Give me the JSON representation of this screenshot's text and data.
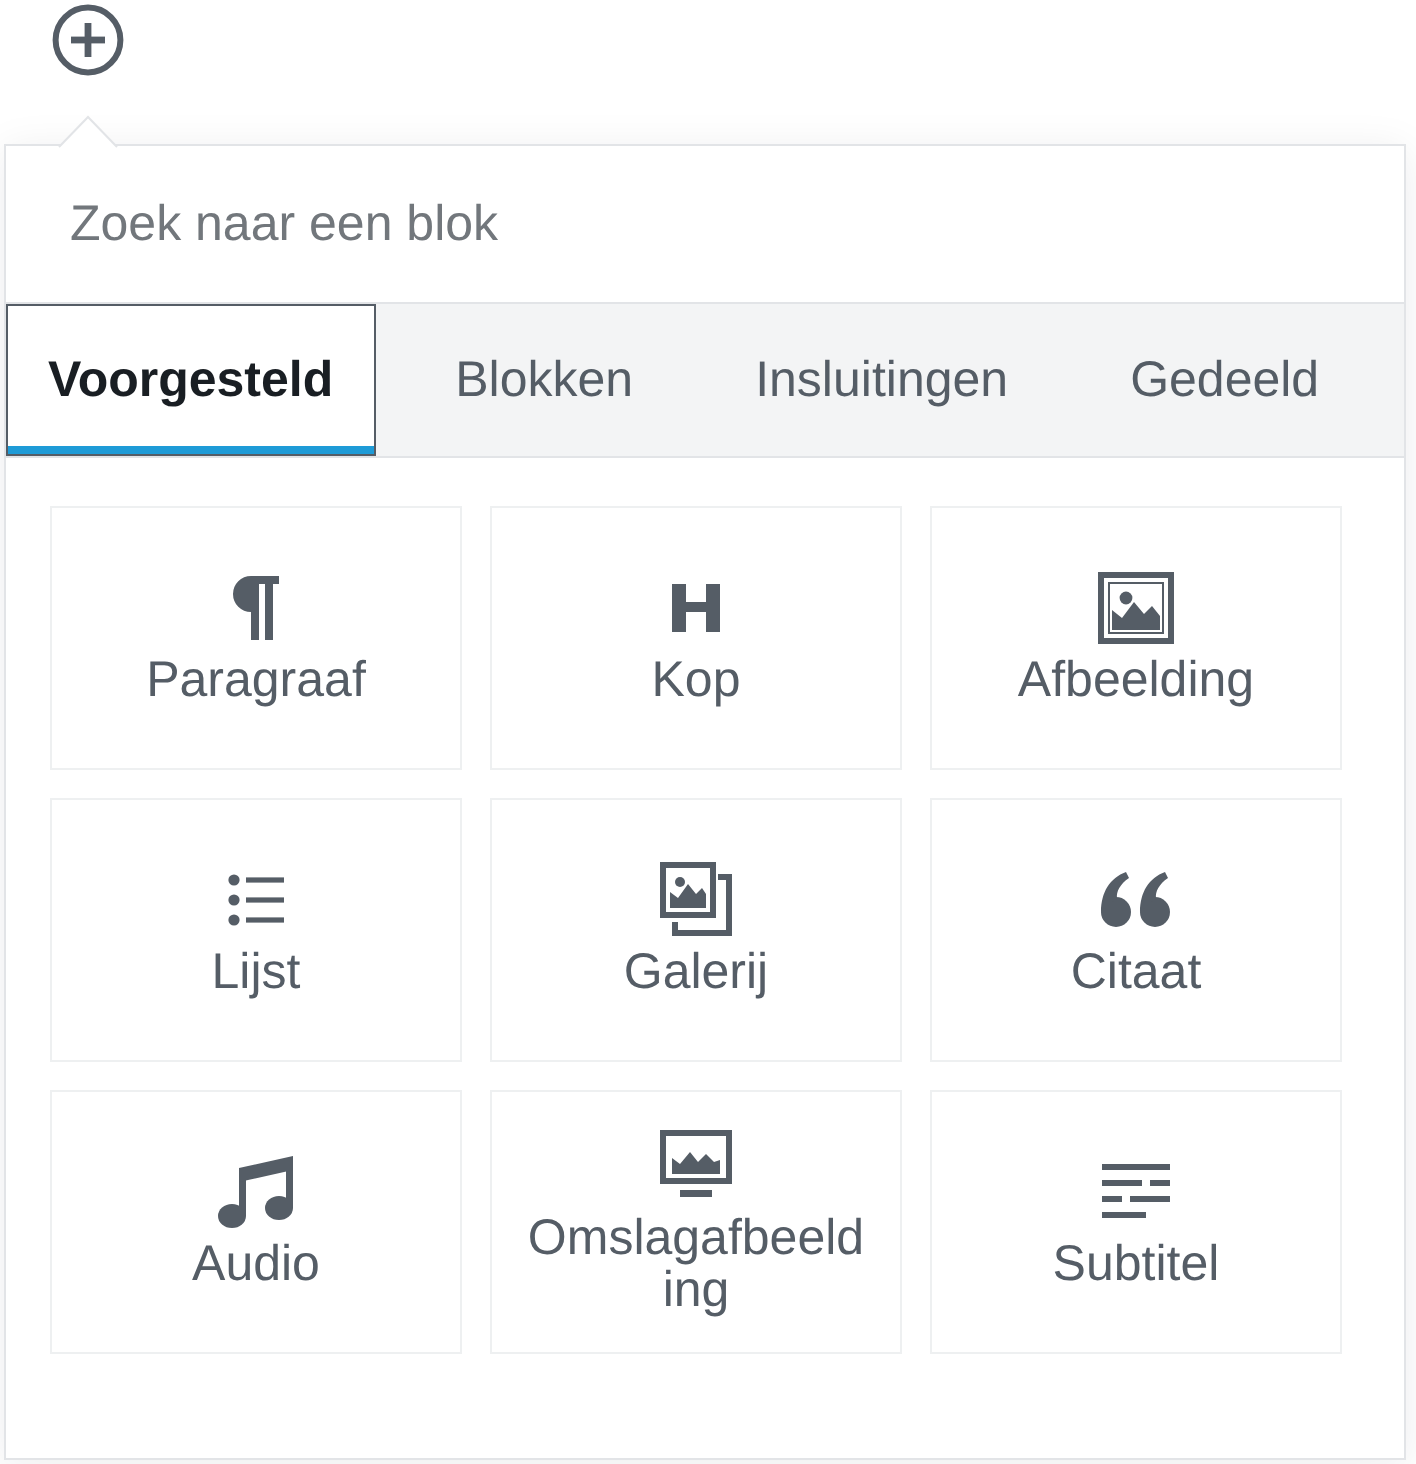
{
  "search": {
    "placeholder": "Zoek naar een blok"
  },
  "tabs": [
    {
      "label": "Voorgesteld",
      "selected": true
    },
    {
      "label": "Blokken",
      "selected": false
    },
    {
      "label": "Insluitingen",
      "selected": false
    },
    {
      "label": "Gedeeld",
      "selected": false
    }
  ],
  "blocks": [
    {
      "kind": "paragraph",
      "label": "Paragraaf"
    },
    {
      "kind": "heading",
      "label": "Kop"
    },
    {
      "kind": "image",
      "label": "Afbeelding"
    },
    {
      "kind": "list",
      "label": "Lijst"
    },
    {
      "kind": "gallery",
      "label": "Galerij"
    },
    {
      "kind": "quote",
      "label": "Citaat"
    },
    {
      "kind": "audio",
      "label": "Audio"
    },
    {
      "kind": "cover",
      "label": "Omslagafbeelding"
    },
    {
      "kind": "subtitle",
      "label": "Subtitel"
    }
  ]
}
